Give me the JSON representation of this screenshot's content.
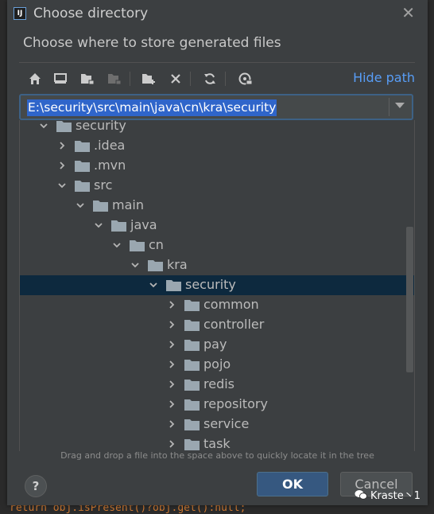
{
  "dialog": {
    "title": "Choose directory",
    "subtitle": "Choose where to store generated files",
    "hide_path": "Hide path",
    "path": "E:\\security\\src\\main\\java\\cn\\kra\\security",
    "hint": "Drag and drop a file into the space above to quickly locate it in the tree",
    "ok_label": "OK",
    "cancel_label": "Cancel",
    "help_label": "?"
  },
  "toolbar": {
    "buttons": [
      "home-icon",
      "desktop-icon",
      "project-folder-icon",
      "module-folder-icon",
      "new-folder-icon",
      "delete-icon",
      "refresh-icon",
      "show-hidden-icon"
    ]
  },
  "tree": [
    {
      "label": "security",
      "depth": 0,
      "expanded": true
    },
    {
      "label": ".idea",
      "depth": 1,
      "expanded": false
    },
    {
      "label": ".mvn",
      "depth": 1,
      "expanded": false
    },
    {
      "label": "src",
      "depth": 1,
      "expanded": true
    },
    {
      "label": "main",
      "depth": 2,
      "expanded": true
    },
    {
      "label": "java",
      "depth": 3,
      "expanded": true
    },
    {
      "label": "cn",
      "depth": 4,
      "expanded": true
    },
    {
      "label": "kra",
      "depth": 5,
      "expanded": true
    },
    {
      "label": "security",
      "depth": 6,
      "expanded": true,
      "selected": true
    },
    {
      "label": "common",
      "depth": 7,
      "expanded": false
    },
    {
      "label": "controller",
      "depth": 7,
      "expanded": false
    },
    {
      "label": "pay",
      "depth": 7,
      "expanded": false
    },
    {
      "label": "pojo",
      "depth": 7,
      "expanded": false
    },
    {
      "label": "redis",
      "depth": 7,
      "expanded": false
    },
    {
      "label": "repository",
      "depth": 7,
      "expanded": false
    },
    {
      "label": "service",
      "depth": 7,
      "expanded": false
    },
    {
      "label": "task",
      "depth": 7,
      "expanded": false
    }
  ],
  "background": {
    "bottom_code": "return obj.isPresent()?obj.get():null;"
  },
  "watermark": "Kraste丶1",
  "colors": {
    "dialog_bg": "#3c3f41",
    "selection_bg": "#0d293e",
    "accent_link": "#589df6",
    "ok_button": "#365880",
    "path_highlight": "#2f65ca",
    "folder": "#9aa7b0"
  }
}
